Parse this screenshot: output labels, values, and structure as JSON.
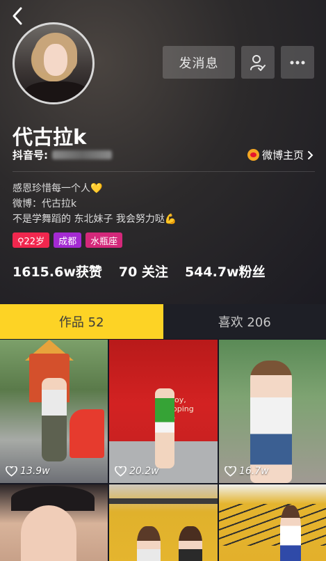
{
  "profile": {
    "name": "代古拉k",
    "douyin_label": "抖音号:",
    "weibo_link": "微博主页",
    "bio": [
      "感恩珍惜每一个人💛",
      "微博：代古拉k",
      "不是学舞蹈的 东北妹子 我会努力哒💪"
    ],
    "tags": [
      {
        "label": "⚲22岁",
        "color": "#f0274e"
      },
      {
        "label": "成都",
        "color": "#a42ad2"
      },
      {
        "label": "水瓶座",
        "color": "#d4287a"
      }
    ],
    "stats": {
      "likes": "1615.6w获赞",
      "following": "70 关注",
      "followers": "544.7w粉丝"
    }
  },
  "actions": {
    "message_button": "发消息"
  },
  "tabs": {
    "works": "作品 52",
    "likes": "喜欢 206"
  },
  "videos": [
    {
      "likes": "13.9w"
    },
    {
      "likes": "20.2w"
    },
    {
      "likes": "16.7w"
    }
  ],
  "thumb_text": {
    "sign": "njoy,\nopping\nre"
  },
  "colors": {
    "tab_active": "#fdd325",
    "background": "#161823",
    "accent_pink": "#f0274e"
  },
  "icons": [
    "back-icon",
    "follow-user-icon",
    "more-icon",
    "weibo-icon",
    "chevron-right-icon",
    "heart-icon"
  ]
}
